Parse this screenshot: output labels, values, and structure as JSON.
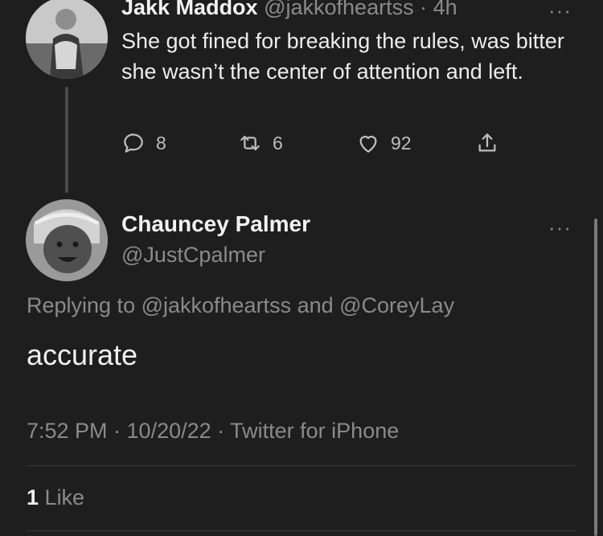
{
  "parent_tweet": {
    "name": "Jakk Maddox",
    "handle": "@jakkofheartss",
    "time": "· 4h",
    "text": "She got fined for breaking the rules, was bitter she wasn’t the center of attention and left.",
    "more_icon": "more-dots-icon",
    "actions": {
      "replies": "8",
      "retweets": "6",
      "likes": "92"
    }
  },
  "main_tweet": {
    "name": "Chauncey Palmer",
    "handle": "@JustCpalmer",
    "replying_to": "Replying to @jakkofheartss and @CoreyLay",
    "text": "accurate",
    "meta": "7:52 PM · 10/20/22 · Twitter for iPhone",
    "like_count": "1",
    "like_label": "Like"
  },
  "colors": {
    "background": "#1e1e1e",
    "text": "#e8e8e8",
    "muted": "#8a8a8a"
  }
}
